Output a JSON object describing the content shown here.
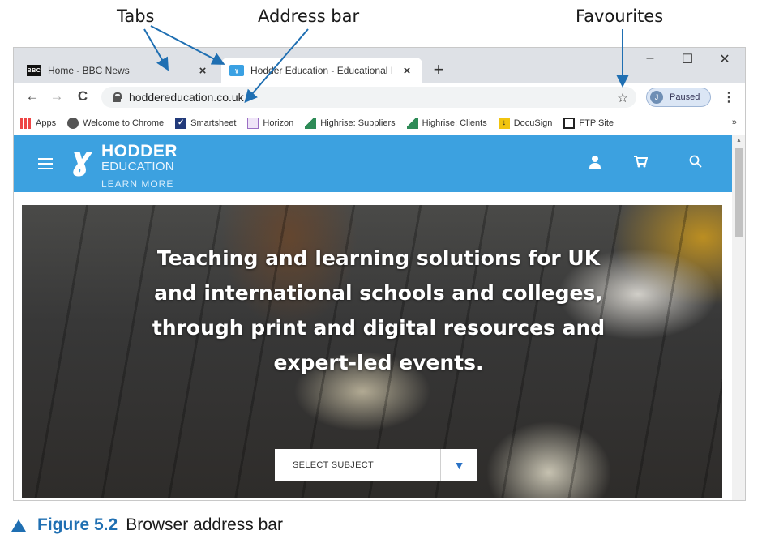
{
  "annotations": {
    "tabs": "Tabs",
    "address_bar": "Address bar",
    "favourites": "Favourites"
  },
  "browser": {
    "tabs": [
      {
        "title": "Home - BBC News",
        "favicon": "bbc-icon",
        "close": "×"
      },
      {
        "title": "Hodder Education - Educational I",
        "favicon": "hodder-icon",
        "close": "×"
      }
    ],
    "new_tab": "+",
    "window_controls": {
      "minimize": "–",
      "maximize": "☐",
      "close": "✕"
    },
    "toolbar": {
      "back": "←",
      "forward": "→",
      "reload": "C",
      "url": "hoddereducation.co.uk",
      "star": "☆",
      "profile_initial": "J",
      "profile_label": "Paused",
      "menu": "⋮"
    },
    "bookmarks": [
      {
        "label": "Apps",
        "icon": "apps-grid-icon"
      },
      {
        "label": "Welcome to Chrome",
        "icon": "chrome-icon"
      },
      {
        "label": "Smartsheet",
        "icon": "smartsheet-icon"
      },
      {
        "label": "Horizon",
        "icon": "horizon-icon"
      },
      {
        "label": "Highrise: Suppliers",
        "icon": "highrise-icon"
      },
      {
        "label": "Highrise: Clients",
        "icon": "highrise-icon"
      },
      {
        "label": "DocuSign",
        "icon": "docusign-icon"
      },
      {
        "label": "FTP Site",
        "icon": "ftp-grid-icon"
      }
    ],
    "bookmarks_more": "»"
  },
  "site": {
    "logo": {
      "hodder": "HODDER",
      "education": "EDUCATION",
      "learn_more": "LEARN MORE"
    },
    "header_icons": [
      "user-icon",
      "cart-icon",
      "search-icon"
    ],
    "hero_text": "Teaching and learning solutions for UK and international schools and colleges, through print and digital resources and expert-led events.",
    "select_subject": "SELECT SUBJECT"
  },
  "caption": {
    "figure": "Figure 5.2",
    "text": "Browser address bar"
  },
  "colors": {
    "site_header": "#3ca1e0",
    "figure_blue": "#1f6fb2",
    "chrome_frame": "#dee1e6"
  }
}
